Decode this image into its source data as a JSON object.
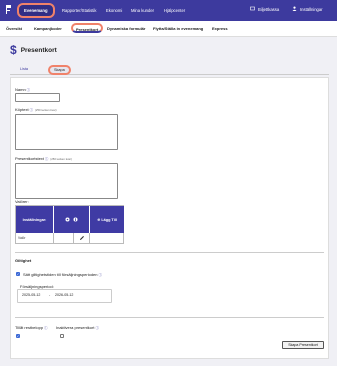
{
  "topnav": {
    "items": [
      "Evenemang",
      "Rapporter/Statistik",
      "Ekonomi",
      "Mina kunder",
      "Hjälpcenter"
    ],
    "biljettkassa": "Biljettkassa",
    "installningar": "Inställningar"
  },
  "subnav": {
    "items": [
      "Översikt",
      "Kampanjkoder",
      "Presentkort",
      "Dynamiska formulär",
      "Flytta/Ställa in evenemang",
      "Express"
    ]
  },
  "page": {
    "title": "Presentkort"
  },
  "tabs": [
    "Lista",
    "Skapa"
  ],
  "form": {
    "namn_label": "Namn",
    "kop_label": "Köptext",
    "kop_hint": "(250 tecken kvar)",
    "present_label": "Presentkortstext",
    "present_hint": "(250 tecken kvar)",
    "valorer_label": "Valörer:",
    "table": {
      "col1": "Inställningar:",
      "col3": "Lägg Till",
      "row_label": "Valör"
    },
    "giltighet_heading": "Giltighet",
    "satt_label": "Sätt giltighetstiden till försäljningsperioden",
    "forsaljning_label": "Försäljningsperiod:",
    "date_from": "2025-05-12",
    "date_sep": "-",
    "date_to": "2026-05-12",
    "tillat_label": "Tillåt restbelopp",
    "inaktivera_label": "Inaktivera presentkort",
    "submit_label": "Skapa Presentkort"
  }
}
